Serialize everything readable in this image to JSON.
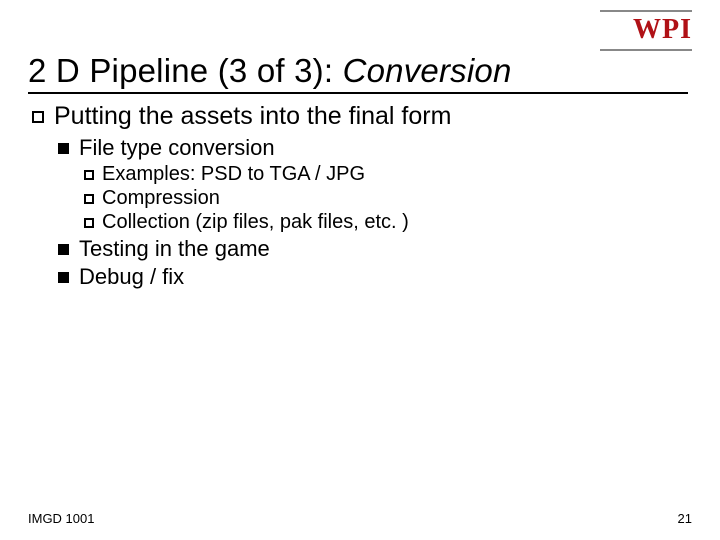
{
  "logo": "WPI",
  "title_prefix": "2 D Pipeline (3 of 3): ",
  "title_emph": "Conversion",
  "bullets": {
    "l1_1": "Putting the assets into the final form",
    "l2_1": "File type conversion",
    "l3_1": "Examples: PSD to TGA / JPG",
    "l3_2": "Compression",
    "l3_3": "Collection (zip files, pak files, etc. )",
    "l2_2": "Testing in the game",
    "l2_3": "Debug / fix"
  },
  "footer": {
    "left": "IMGD 1001",
    "right": "21"
  }
}
